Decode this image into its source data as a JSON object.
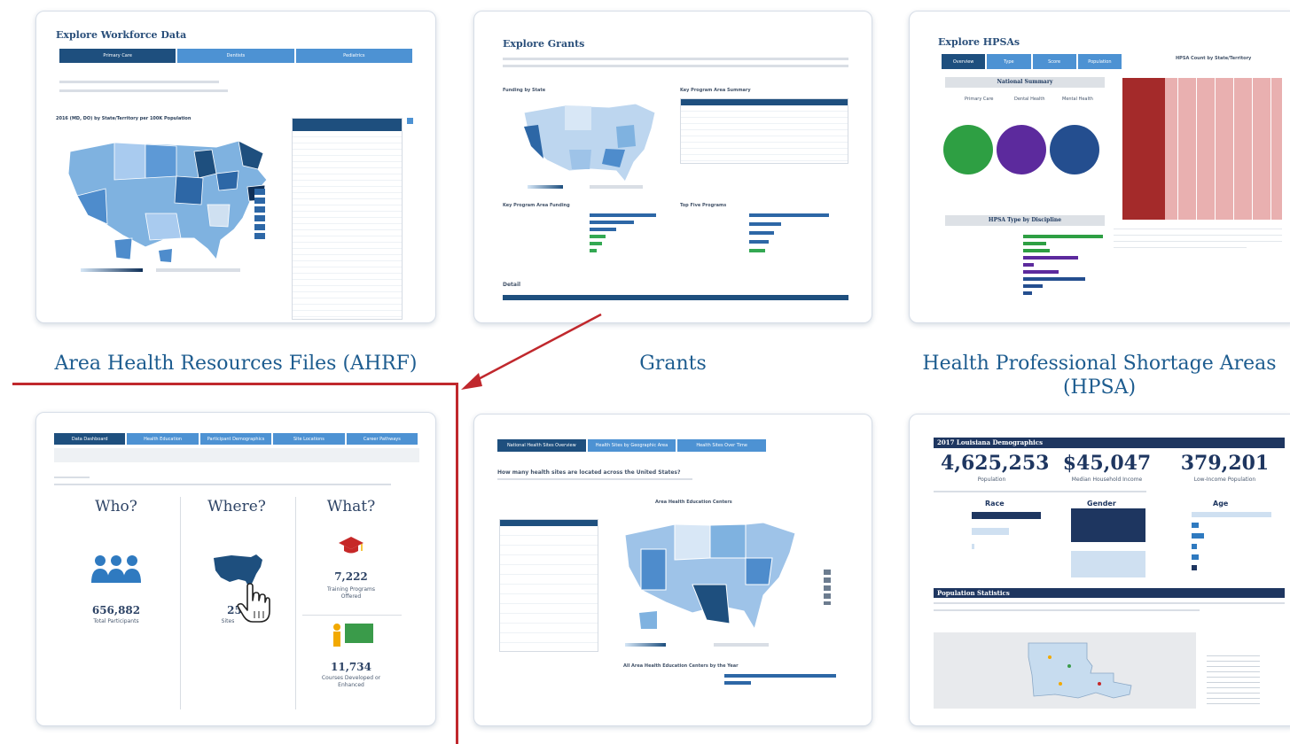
{
  "cards": {
    "workforce": {
      "title": "Explore Workforce Data",
      "tabs": [
        "Primary Care",
        "Dentists",
        "Pediatrics"
      ],
      "map_title": "2016 (MD, DO) by State/Territory per 100K Population"
    },
    "grants": {
      "title": "Explore Grants",
      "sections": [
        "Funding by State",
        "Key Program Area Summary",
        "Key Program Area Funding",
        "Top Five Programs",
        "Detail"
      ]
    },
    "hpsa": {
      "title": "Explore HPSAs",
      "tabs": [
        "Overview",
        "Type",
        "Score",
        "Population"
      ],
      "national_summary": "National Summary",
      "col_labels": [
        "Primary Care",
        "Dental Health",
        "Mental Health"
      ],
      "treemap_title": "HPSA Count by State/Territory",
      "discipline_title": "HPSA Type by Discipline"
    },
    "warehouse": {
      "tabs": [
        "Data Dashboard",
        "Health Education",
        "Participant Demographics",
        "Site Locations",
        "Career Pathways"
      ],
      "who": "Who?",
      "where": "Where?",
      "what": "What?",
      "participants_value": "656,882",
      "participants_label": "Total Participants",
      "sites_value": "25,",
      "sites_label": "Sites",
      "programs_value": "7,222",
      "programs_label": "Training Programs Offered",
      "courses_value": "11,734",
      "courses_label": "Courses Developed or Enhanced"
    },
    "ahec": {
      "tabs": [
        "National Health Sites Overview",
        "Health Sites by Geographic Area",
        "Health Sites Over Time"
      ],
      "question": "How many health sites are located across the United States?",
      "map_title": "Area Health Education Centers",
      "bar_title": "All Area Health Education Centers by the Year"
    },
    "demographics": {
      "header": "2017 Louisiana Demographics",
      "population_value": "4,625,253",
      "population_label": "Population",
      "income_value": "$45,047",
      "income_label": "Median Household Income",
      "lowincome_value": "379,201",
      "lowincome_label": "Low-Income Population",
      "race": "Race",
      "gender": "Gender",
      "age": "Age",
      "stats_header": "Population Statistics"
    }
  },
  "captions": {
    "ahrf": "Area Health Resources Files (AHRF)",
    "grants": "Grants",
    "hpsa_line1": "Health Professional Shortage Areas",
    "hpsa_line2": "(HPSA)"
  },
  "colors": {
    "accent_red": "#c0282d",
    "navy": "#1e4f7e",
    "tab_blue": "#4d92d3",
    "caption_blue": "#1d5c8f"
  }
}
